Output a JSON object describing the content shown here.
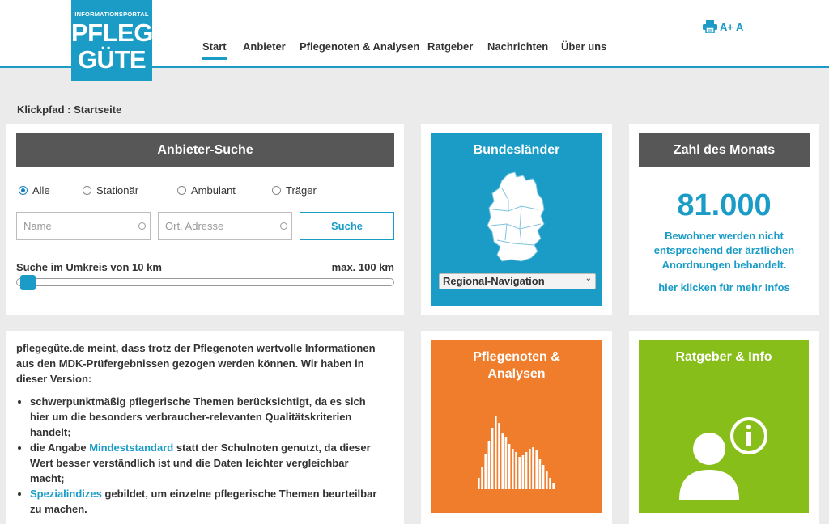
{
  "logo": {
    "small": "INFORMATIONSPORTAL",
    "line1": "PFLEGE",
    "line2": "GÜTE"
  },
  "nav": [
    "Start",
    "Anbieter",
    "Pflegenoten & Analysen",
    "Ratgeber",
    "Nachrichten",
    "Über uns"
  ],
  "tools": {
    "font_larger": "A+",
    "font_normal": "A"
  },
  "breadcrumb": "Klickpfad : Startseite",
  "search": {
    "title": "Anbieter-Suche",
    "radios": [
      "Alle",
      "Stationär",
      "Ambulant",
      "Träger"
    ],
    "selected": "Alle",
    "name_placeholder": "Name",
    "location_placeholder": "Ort, Adresse",
    "button": "Suche",
    "radius_label": "Suche im Umkreis von 10 km",
    "max_label": "max. 100 km",
    "radius_value_km": 10,
    "radius_max_km": 100
  },
  "bundeslaender": {
    "title": "Bundesländer",
    "select_value": "Regional-Navigation"
  },
  "zahl": {
    "title": "Zahl des Monats",
    "number": "81.000",
    "desc_lines": [
      "Bewohner werden nicht",
      "entsprechend der ärztlichen",
      "Anordnungen behandelt."
    ],
    "link": "hier klicken für mehr Infos"
  },
  "intro": {
    "paragraph_lines": [
      "pflegegüte.de meint, dass trotz der Pflegenoten wertvolle Informationen",
      "aus den MDK-Prüfergebnissen gezogen werden können. Wir haben in",
      "dieser Version:"
    ],
    "b1_lines": [
      "schwerpunktmäßig pflegerische Themen berücksichtigt, da es sich",
      "hier um die besonders verbraucher-relevanten Qualitätskriterien",
      "handelt;"
    ],
    "b2_pre": "die Angabe ",
    "b2_link": "Mindeststandard",
    "b2_post": " statt der Schulnoten genutzt, da dieser",
    "b2_lines": [
      "Wert besser verständlich ist und die Daten leichter vergleichbar",
      "macht;"
    ],
    "b3_link": "Spezialindizes",
    "b3_post": " gebildet, um einzelne pflegerische Themen beurteilbar",
    "b3_lines": [
      "zu machen."
    ]
  },
  "tile_pflegenoten": {
    "title_lines": [
      "Pflegenoten &",
      "Analysen"
    ]
  },
  "tile_ratgeber": {
    "title": "Ratgeber & Info"
  },
  "colors": {
    "blue": "#1a9cc7",
    "orange": "#f07d2b",
    "green": "#88be1a",
    "dark": "#575757"
  },
  "icons": [
    "print-icon",
    "germany-map-icon",
    "histogram-icon",
    "person-info-icon",
    "chevron-down-icon"
  ]
}
